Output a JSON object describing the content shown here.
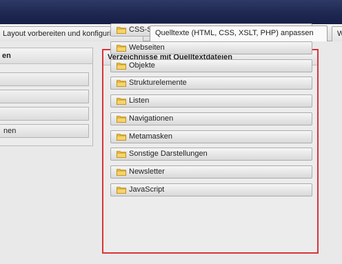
{
  "tabs": [
    {
      "label": "Layout vorbereiten und konfigurieren",
      "active": false
    },
    {
      "label": "Quelltexte (HTML, CSS, XSLT, PHP) anpassen",
      "active": true
    },
    {
      "label": "W",
      "active": false
    }
  ],
  "left_panel": {
    "title": "en",
    "items": [
      "",
      "",
      "",
      "nen"
    ]
  },
  "main_panel": {
    "title": "Verzeichnisse mit Quelltextdateien",
    "items": [
      "CSS-Stylesheets",
      "Webseiten",
      "Objekte",
      "Strukturelemente",
      "Listen",
      "Navigationen",
      "Metamasken",
      "Sonstige Darstellungen",
      "Newsletter",
      "JavaScript"
    ]
  },
  "colors": {
    "titlebar": "#1d2750",
    "highlight_border": "#d93337",
    "folder": "#f2c443"
  },
  "icons": {
    "folder": "folder-icon"
  }
}
